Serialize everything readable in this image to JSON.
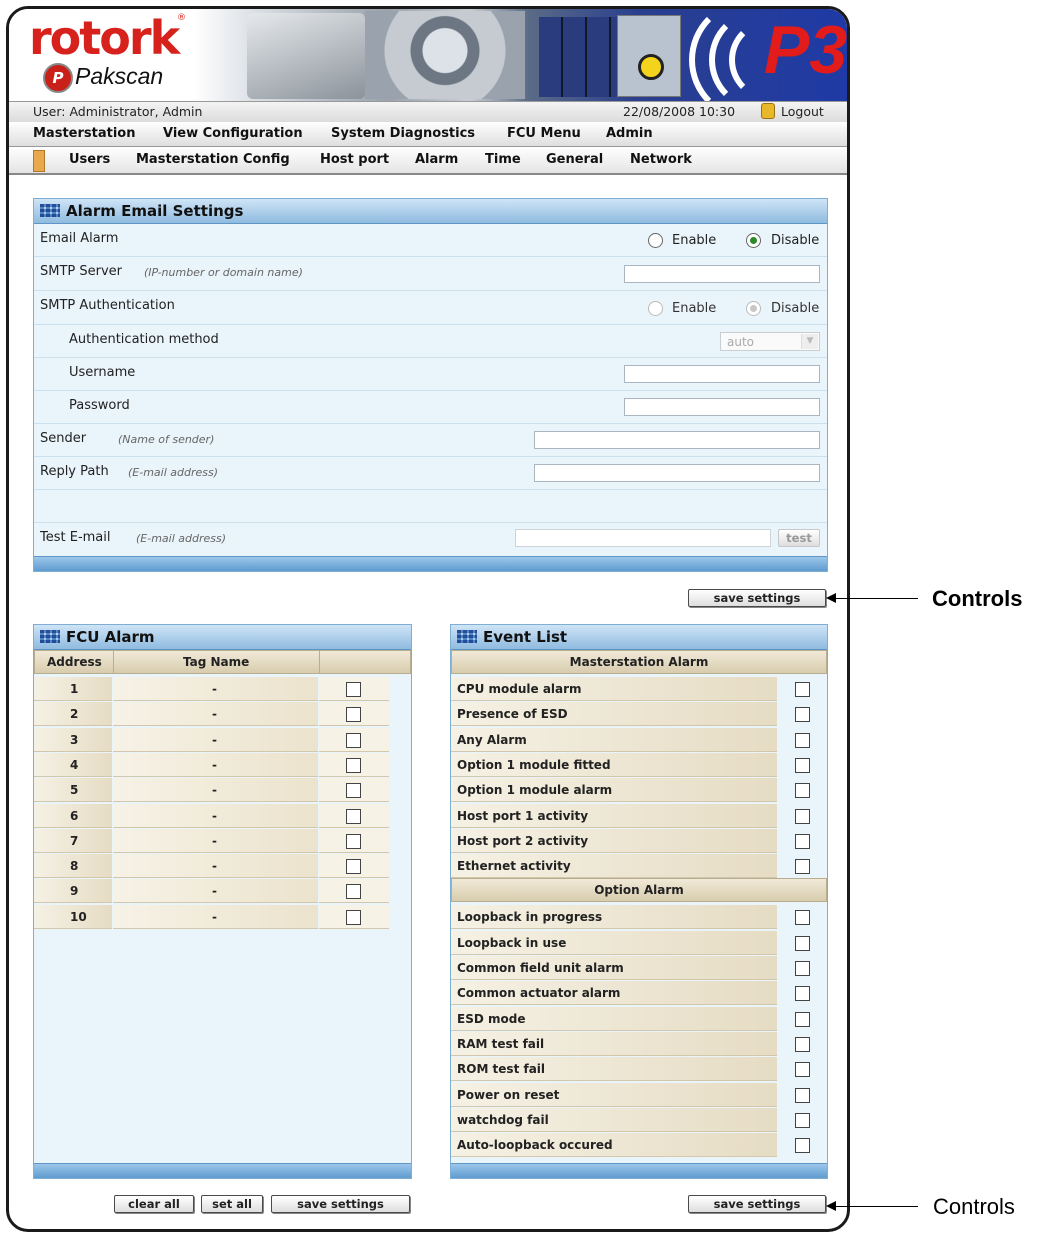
{
  "brand": {
    "logo_text": "rotork",
    "registered_mark": "®",
    "product_badge": "P",
    "product_name": "Pakscan",
    "version_logo": "P3"
  },
  "status": {
    "user_label": "User: Administrator, Admin",
    "datetime": "22/08/2008 10:30",
    "logout": "Logout"
  },
  "menu": [
    "Masterstation",
    "View Configuration",
    "System Diagnostics",
    "FCU Menu",
    "Admin"
  ],
  "submenu": [
    "Users",
    "Masterstation Config",
    "Host port",
    "Alarm",
    "Time",
    "General",
    "Network"
  ],
  "email_settings": {
    "title": "Alarm Email Settings",
    "email_alarm": {
      "label": "Email Alarm",
      "options": [
        "Enable",
        "Disable"
      ],
      "selected": "Disable"
    },
    "smtp_server": {
      "label": "SMTP Server",
      "hint": "(IP-number or domain name)",
      "value": ""
    },
    "smtp_auth": {
      "label": "SMTP Authentication",
      "options": [
        "Enable",
        "Disable"
      ],
      "selected": "Disable",
      "disabled": true
    },
    "auth_method": {
      "label": "Authentication method",
      "value": "auto"
    },
    "username": {
      "label": "Username",
      "value": ""
    },
    "password": {
      "label": "Password",
      "value": ""
    },
    "sender": {
      "label": "Sender",
      "hint": "(Name of sender)",
      "value": ""
    },
    "reply_path": {
      "label": "Reply Path",
      "hint": "(E-mail address)",
      "value": ""
    },
    "test_email": {
      "label": "Test E-mail",
      "hint": "(E-mail address)",
      "value": "",
      "button": "test"
    },
    "save_button": "save settings"
  },
  "fcu_alarm": {
    "title": "FCU Alarm",
    "columns": [
      "Address",
      "Tag Name",
      ""
    ],
    "rows": [
      {
        "address": "1",
        "tag": "-",
        "checked": false
      },
      {
        "address": "2",
        "tag": "-",
        "checked": false
      },
      {
        "address": "3",
        "tag": "-",
        "checked": false
      },
      {
        "address": "4",
        "tag": "-",
        "checked": false
      },
      {
        "address": "5",
        "tag": "-",
        "checked": false
      },
      {
        "address": "6",
        "tag": "-",
        "checked": false
      },
      {
        "address": "7",
        "tag": "-",
        "checked": false
      },
      {
        "address": "8",
        "tag": "-",
        "checked": false
      },
      {
        "address": "9",
        "tag": "-",
        "checked": false
      },
      {
        "address": "10",
        "tag": "-",
        "checked": false
      }
    ],
    "buttons": {
      "clear_all": "clear all",
      "set_all": "set all",
      "save": "save settings"
    }
  },
  "event_list": {
    "title": "Event List",
    "groups": [
      {
        "header": "Masterstation Alarm",
        "items": [
          "CPU module alarm",
          "Presence of ESD",
          "Any Alarm",
          "Option 1 module fitted",
          "Option 1 module alarm",
          "Host port 1 activity",
          "Host port 2 activity",
          "Ethernet activity"
        ]
      },
      {
        "header": "Option Alarm",
        "items": [
          "Loopback in progress",
          "Loopback in use",
          "Common field unit alarm",
          "Common actuator alarm",
          "ESD mode",
          "RAM test fail",
          "ROM test fail",
          "Power on reset",
          "watchdog fail",
          "Auto-loopback occured"
        ]
      }
    ],
    "save_button": "save settings"
  },
  "callouts": {
    "top": "Controls",
    "bottom": "Controls"
  },
  "colors": {
    "brand_red": "#d6211c",
    "panel_header": "#8fbbe0",
    "panel_bg": "#eaf4fb",
    "row_shade": "#e6dcc4"
  }
}
